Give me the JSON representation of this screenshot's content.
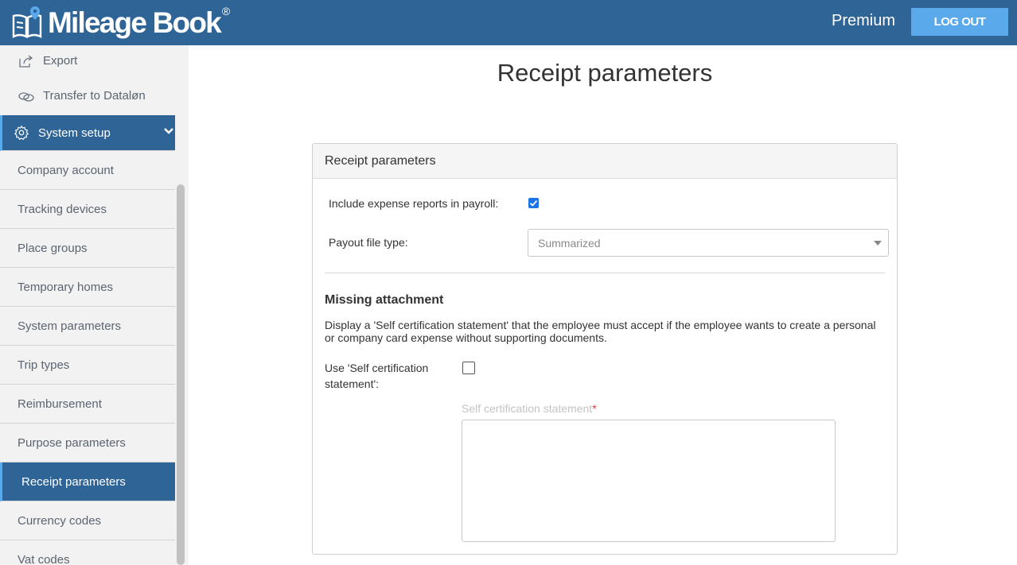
{
  "header": {
    "brand": "Mileage Book",
    "brand_mark": "®",
    "plan": "Premium",
    "logout_label": "LOG OUT",
    "colors": {
      "bar": "#2f6496",
      "button": "#5aa9eb"
    }
  },
  "sidebar": {
    "top_items": [
      {
        "label": "Export",
        "icon": "export-icon"
      },
      {
        "label": "Transfer to Dataløn",
        "icon": "link-icon"
      }
    ],
    "section": {
      "label": "System setup",
      "icon": "gear-icon",
      "expanded": true
    },
    "items": [
      {
        "label": "Company account"
      },
      {
        "label": "Tracking devices"
      },
      {
        "label": "Place groups"
      },
      {
        "label": "Temporary homes"
      },
      {
        "label": "System parameters"
      },
      {
        "label": "Trip types"
      },
      {
        "label": "Reimbursement"
      },
      {
        "label": "Purpose parameters"
      },
      {
        "label": "Receipt parameters",
        "active": true
      },
      {
        "label": "Currency codes"
      },
      {
        "label": "Vat codes"
      }
    ]
  },
  "main": {
    "title": "Receipt parameters",
    "panel": {
      "header": "Receipt parameters",
      "include_label": "Include expense reports in payroll:",
      "include_checked": true,
      "payout_label": "Payout file type:",
      "payout_value": "Summarized",
      "missing_title": "Missing attachment",
      "missing_desc": "Display a 'Self certification statement' that the employee must accept if the employee wants to create a personal or company card expense without supporting documents.",
      "use_label": "Use 'Self certification statement':",
      "use_checked": false,
      "statement_label": "Self certification statement",
      "required_mark": "*",
      "statement_value": ""
    }
  }
}
